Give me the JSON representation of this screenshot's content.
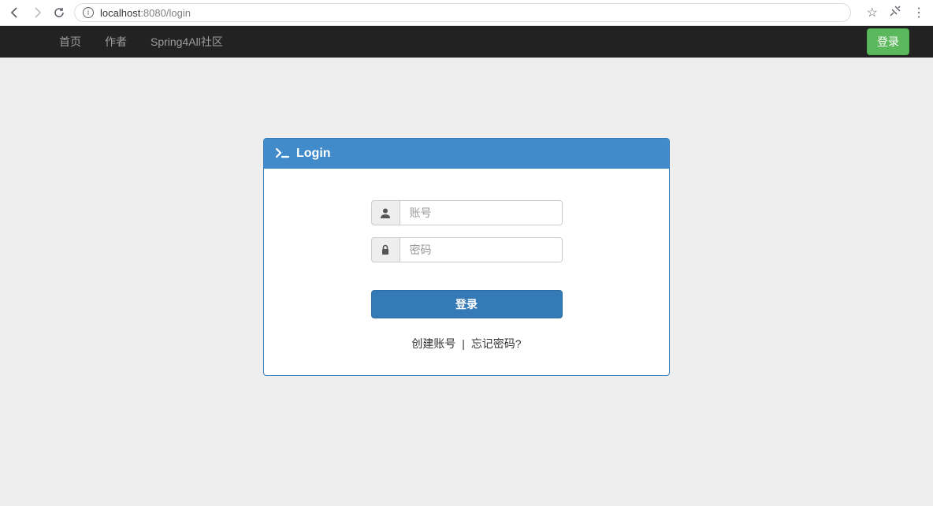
{
  "browser": {
    "url_host": "localhost",
    "url_port": ":8080",
    "url_path": "/login"
  },
  "navbar": {
    "links": [
      {
        "label": "首页"
      },
      {
        "label": "作者"
      },
      {
        "label": "Spring4All社区"
      }
    ],
    "login_button": "登录"
  },
  "panel": {
    "title": "Login",
    "username_placeholder": "账号",
    "password_placeholder": "密码",
    "submit_label": "登录",
    "create_account": "创建账号",
    "divider": "|",
    "forgot_password": "忘记密码?"
  }
}
